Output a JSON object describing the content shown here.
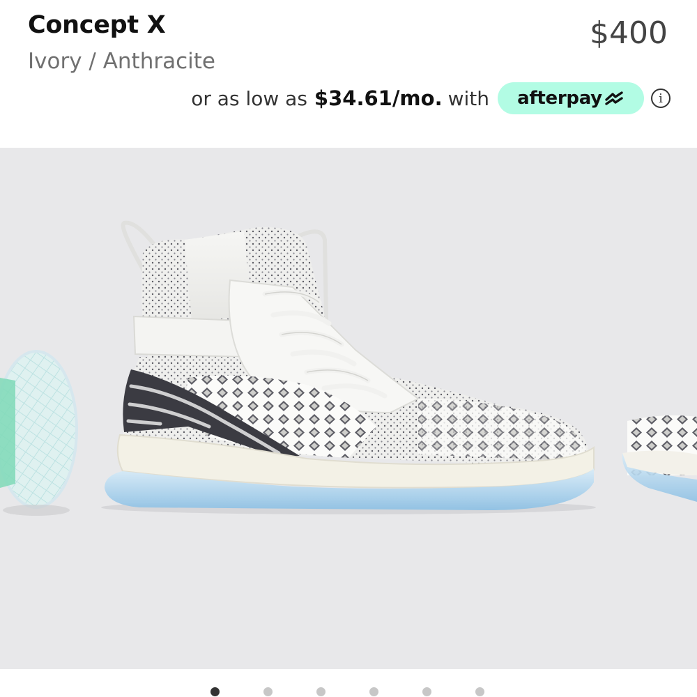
{
  "product": {
    "name": "Concept X",
    "colorway": "Ivory / Anthracite",
    "price": "$400"
  },
  "installment": {
    "prefix": "or as low as",
    "amount": "$34.61/mo.",
    "suffix": "with",
    "provider": "afterpay",
    "badge_color": "#b2fce4"
  },
  "carousel": {
    "background": "#e8e8ea",
    "image_count": 6,
    "active_index": 0
  }
}
